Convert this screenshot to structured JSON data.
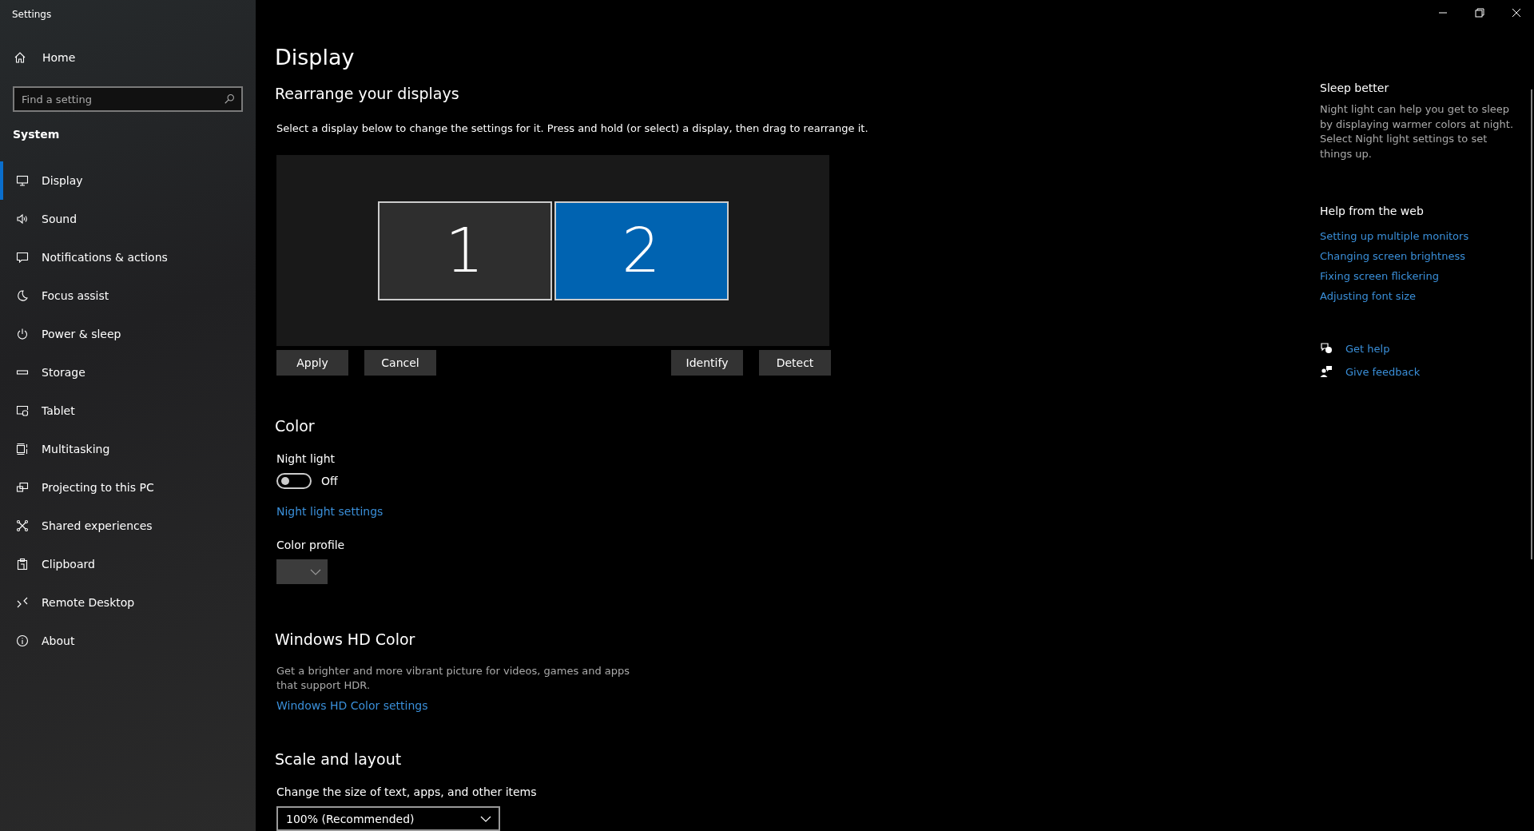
{
  "window": {
    "title": "Settings"
  },
  "sidebar": {
    "home": "Home",
    "search": {
      "placeholder": "Find a setting"
    },
    "section": "System",
    "items": [
      {
        "label": "Display",
        "selected": true
      },
      {
        "label": "Sound",
        "selected": false
      },
      {
        "label": "Notifications & actions",
        "selected": false
      },
      {
        "label": "Focus assist",
        "selected": false
      },
      {
        "label": "Power & sleep",
        "selected": false
      },
      {
        "label": "Storage",
        "selected": false
      },
      {
        "label": "Tablet",
        "selected": false
      },
      {
        "label": "Multitasking",
        "selected": false
      },
      {
        "label": "Projecting to this PC",
        "selected": false
      },
      {
        "label": "Shared experiences",
        "selected": false
      },
      {
        "label": "Clipboard",
        "selected": false
      },
      {
        "label": "Remote Desktop",
        "selected": false
      },
      {
        "label": "About",
        "selected": false
      }
    ]
  },
  "page": {
    "title": "Display",
    "rearrange": {
      "heading": "Rearrange your displays",
      "description": "Select a display below to change the settings for it. Press and hold (or select) a display, then drag to rearrange it.",
      "displays": [
        {
          "number": "1",
          "selected": false
        },
        {
          "number": "2",
          "selected": true
        }
      ],
      "buttons_left": [
        "Apply",
        "Cancel"
      ],
      "buttons_right": [
        "Identify",
        "Detect"
      ]
    },
    "color": {
      "heading": "Color",
      "night_light": {
        "label": "Night light",
        "on": false,
        "state": "Off"
      },
      "link": "Night light settings",
      "profile_label": "Color profile"
    },
    "hd_color": {
      "heading": "Windows HD Color",
      "description": "Get a brighter and more vibrant picture for videos, games and apps that support HDR.",
      "link": "Windows HD Color settings"
    },
    "scale": {
      "heading": "Scale and layout",
      "label": "Change the size of text, apps, and other items",
      "value": "100% (Recommended)"
    }
  },
  "aside": {
    "sleep": {
      "heading": "Sleep better",
      "text": "Night light can help you get to sleep by displaying warmer colors at night. Select Night light settings to set things up."
    },
    "help": {
      "heading": "Help from the web",
      "links": [
        "Setting up multiple monitors",
        "Changing screen brightness",
        "Fixing screen flickering",
        "Adjusting font size"
      ]
    },
    "actions": [
      "Get help",
      "Give feedback"
    ]
  }
}
